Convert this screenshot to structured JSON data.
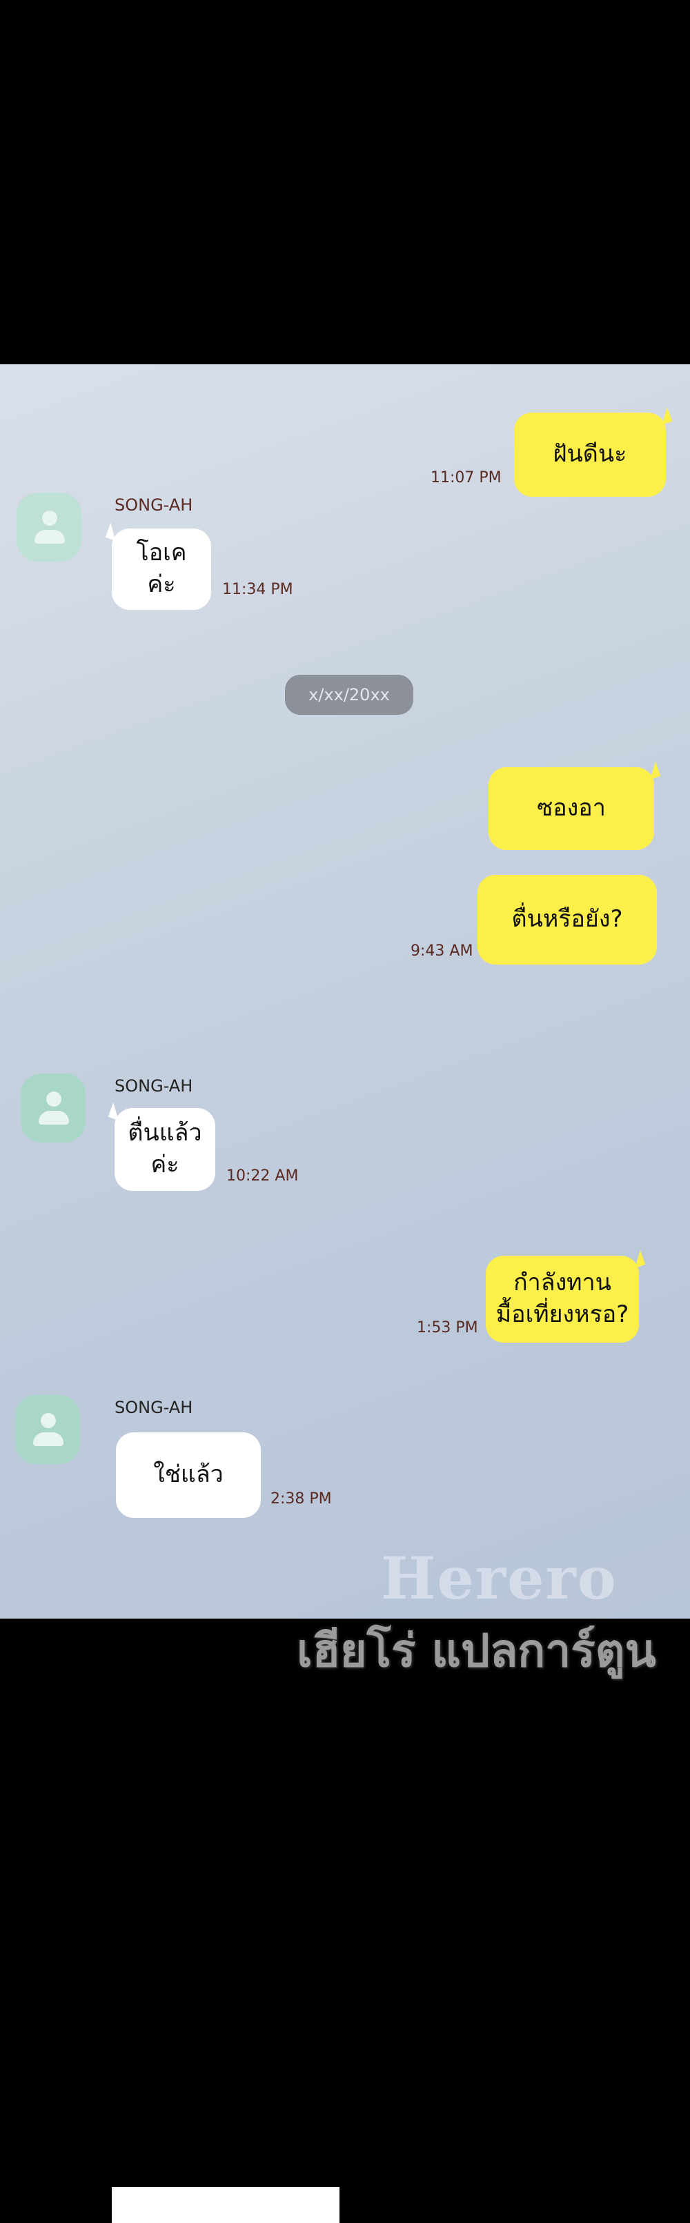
{
  "messages": [
    {
      "side": "out",
      "text": "ฝันดีนะ",
      "time": "11:07 PM"
    },
    {
      "side": "in",
      "sender": "SONG-AH",
      "text": "โอเคค่ะ",
      "time": "11:34 PM"
    },
    {
      "side": "divider",
      "text": "x/xx/20xx"
    },
    {
      "side": "out",
      "text": "ซองอา"
    },
    {
      "side": "out",
      "text": "ตื่นหรือยัง?",
      "time": "9:43 AM"
    },
    {
      "side": "in",
      "sender": "SONG-AH",
      "text": "ตื่นแล้วค่ะ",
      "time": "10:22 AM"
    },
    {
      "side": "out",
      "text_line1": "กำลังทาน",
      "text_line2": "มื้อเที่ยงหรอ?",
      "time": "1:53 PM"
    },
    {
      "side": "in",
      "sender": "SONG-AH",
      "text": "ใช่แล้ว",
      "time": "2:38 PM"
    }
  ],
  "watermark": {
    "line1": "Herero",
    "line2": "เฮียโร่ แปลการ์ตูน"
  },
  "colors": {
    "outgoing_bubble": "#fdef4a",
    "incoming_bubble": "#ffffff",
    "time_text": "#5a2a22",
    "avatar": "#a9d7c7"
  }
}
